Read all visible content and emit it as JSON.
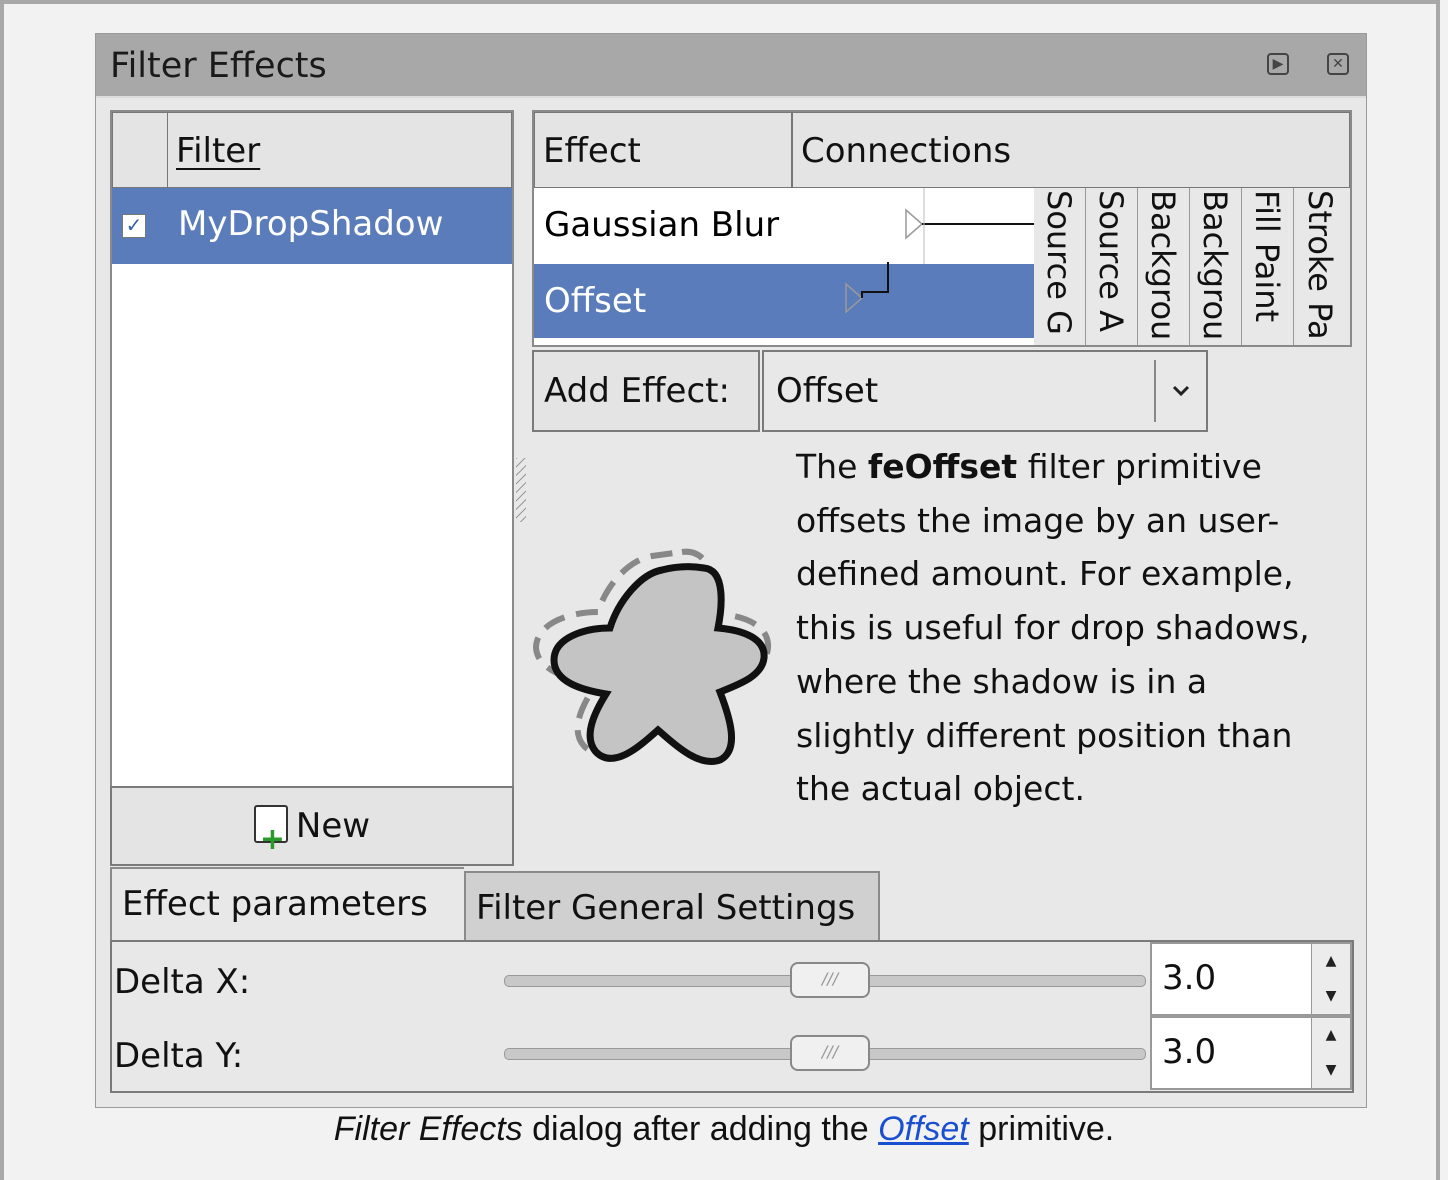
{
  "dialog": {
    "title": "Filter Effects",
    "title_buttons": [
      {
        "icon": "play-icon",
        "glyph": "▶"
      },
      {
        "icon": "close-icon",
        "glyph": "✕"
      }
    ]
  },
  "filters": {
    "header": "Filter",
    "items": [
      {
        "name": "MyDropShadow",
        "checked": true,
        "selected": true
      }
    ],
    "new_button": "New"
  },
  "effects": {
    "header_effect": "Effect",
    "header_connections": "Connections",
    "items": [
      {
        "name": "Gaussian Blur",
        "selected": false
      },
      {
        "name": "Offset",
        "selected": true
      }
    ],
    "inputs": [
      "Source G",
      "Source A",
      "Backgrou",
      "Backgrou",
      "Fill Paint",
      "Stroke Pa"
    ]
  },
  "add_effect": {
    "label": "Add Effect:",
    "selected": "Offset"
  },
  "description": {
    "prefix": "The ",
    "bold": "feOffset",
    "suffix": " filter primitive offsets the image by an user-defined amount. For example, this is useful for drop shadows, where the shadow is in a slightly different position than the actual object."
  },
  "tabs": [
    {
      "label": "Effect parameters",
      "active": true
    },
    {
      "label": "Filter General Settings",
      "active": false
    }
  ],
  "params": [
    {
      "label": "Delta X:",
      "value": "3.0",
      "slider_fraction": 0.5
    },
    {
      "label": "Delta Y:",
      "value": "3.0",
      "slider_fraction": 0.5
    }
  ],
  "caption": {
    "italic": "Filter Effects",
    "middle": " dialog after adding the ",
    "link": "Offset",
    "end": " primitive."
  },
  "colors": {
    "selection": "#5b7cbb",
    "titlebar": "#a8a8a8",
    "link": "#1a4fd0"
  }
}
